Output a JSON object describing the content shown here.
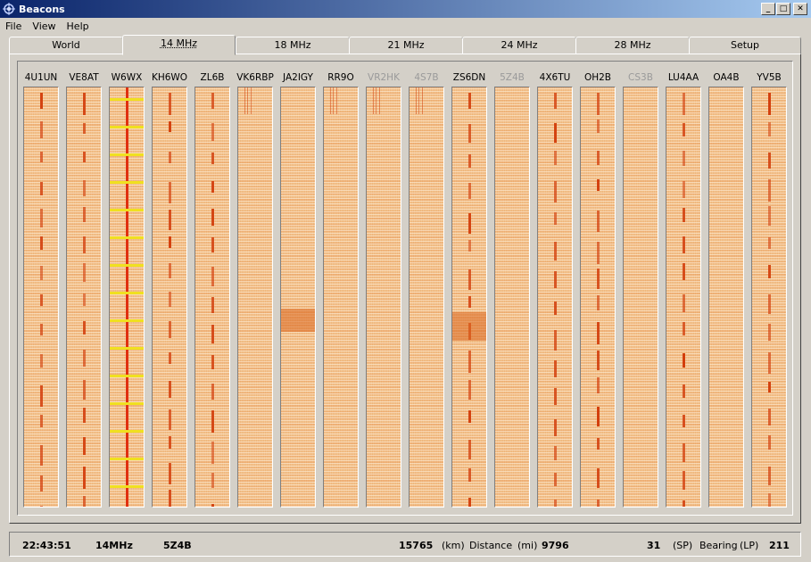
{
  "window": {
    "title": "Beacons"
  },
  "menu": [
    "File",
    "View",
    "Help"
  ],
  "tabs": [
    {
      "label": "World",
      "active": false
    },
    {
      "label": "14 MHz",
      "active": true
    },
    {
      "label": "18 MHz",
      "active": false
    },
    {
      "label": "21 MHz",
      "active": false
    },
    {
      "label": "24 MHz",
      "active": false
    },
    {
      "label": "28 MHz",
      "active": false
    },
    {
      "label": "Setup",
      "active": false
    }
  ],
  "beacons": [
    {
      "call": "4U1UN",
      "dim": false
    },
    {
      "call": "VE8AT",
      "dim": false
    },
    {
      "call": "W6WX",
      "dim": false
    },
    {
      "call": "KH6WO",
      "dim": false
    },
    {
      "call": "ZL6B",
      "dim": false
    },
    {
      "call": "VK6RBP",
      "dim": false
    },
    {
      "call": "JA2IGY",
      "dim": false
    },
    {
      "call": "RR9O",
      "dim": false
    },
    {
      "call": "VR2HK",
      "dim": true
    },
    {
      "call": "4S7B",
      "dim": true
    },
    {
      "call": "ZS6DN",
      "dim": false
    },
    {
      "call": "5Z4B",
      "dim": true
    },
    {
      "call": "4X6TU",
      "dim": false
    },
    {
      "call": "OH2B",
      "dim": false
    },
    {
      "call": "CS3B",
      "dim": true
    },
    {
      "call": "LU4AA",
      "dim": false
    },
    {
      "call": "OA4B",
      "dim": false
    },
    {
      "call": "YV5B",
      "dim": false
    }
  ],
  "status": {
    "time": "22:43:51",
    "band": "14MHz",
    "beacon": "5Z4B",
    "distance_km": "15765",
    "km_label": "(km)",
    "distance_label": "Distance",
    "mi_label": "(mi)",
    "distance_mi": "9796",
    "bearing_sp": "31",
    "sp_label": "(SP)",
    "bearing_label": "Bearing",
    "lp_label": "(LP)",
    "bearing_lp": "211"
  }
}
